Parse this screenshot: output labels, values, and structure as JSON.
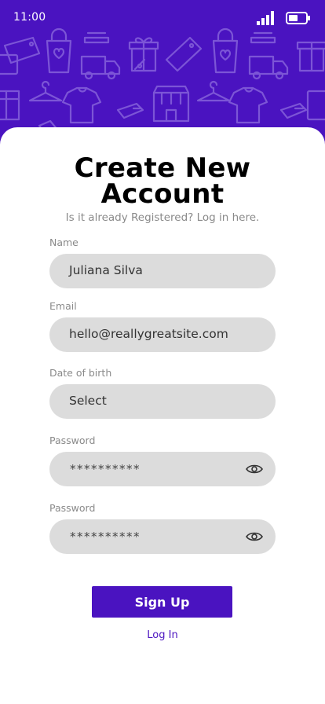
{
  "status_bar": {
    "time": "11:00"
  },
  "form": {
    "title_line1": "Create New",
    "title_line2": "Account",
    "subtitle": "Is it already Registered? Log in here.",
    "name_label": "Name",
    "name_value": "Juliana Silva",
    "email_label": "Email",
    "email_value": "hello@reallygreatsite.com",
    "dob_label": "Date of birth",
    "dob_value": "Select",
    "password_label": "Password",
    "password_value": "**********",
    "confirm_label": "Password",
    "confirm_value": "**********",
    "signup_label": "Sign Up",
    "login_label": "Log In"
  },
  "icons": [
    "signal-icon",
    "battery-icon",
    "eye-icon",
    "shopping-pattern"
  ],
  "colors": {
    "brand": "#4a13c0",
    "field_bg": "#dcdcdc",
    "muted": "#8a8a8a"
  }
}
